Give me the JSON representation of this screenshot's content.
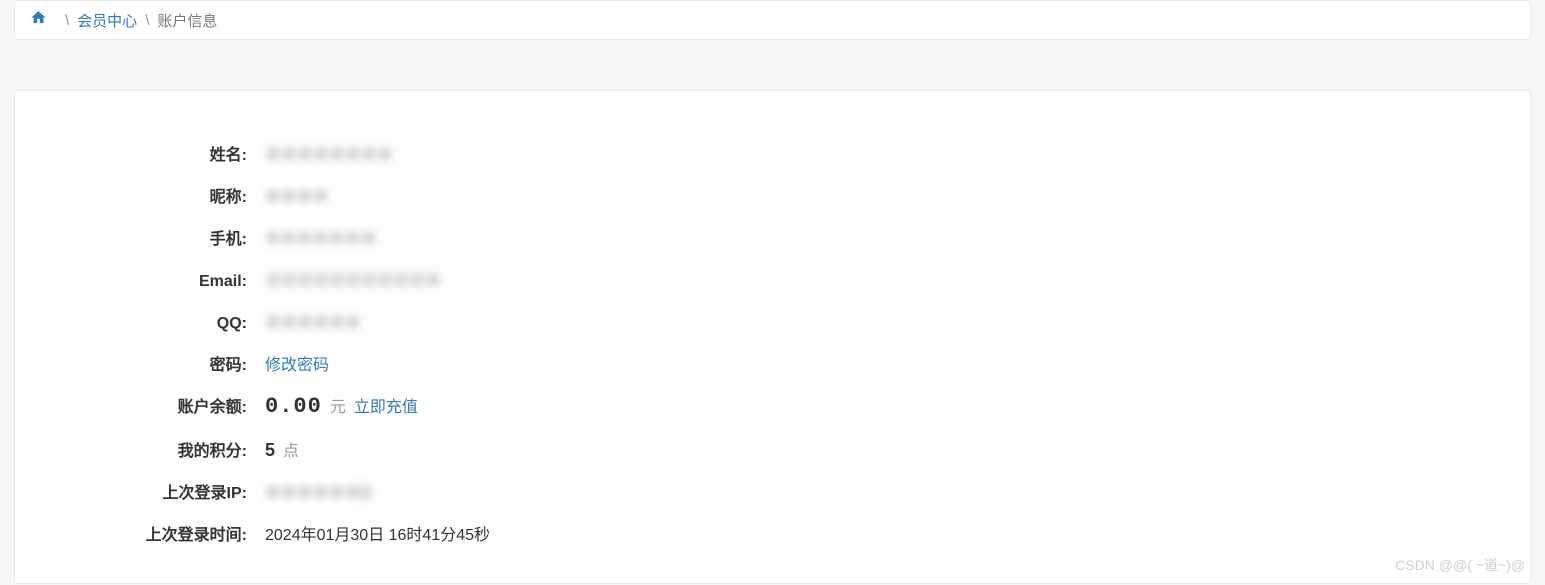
{
  "breadcrumb": {
    "member_center": "会员中心",
    "account_info": "账户信息"
  },
  "info": {
    "name_label": "姓名:",
    "name_value": "＊＊＊＊＊＊＊＊",
    "nick_label": "昵称:",
    "nick_value": "＊＊＊＊",
    "phone_label": "手机:",
    "phone_value": "＊＊＊＊＊＊＊",
    "email_label": "Email:",
    "email_value": "＊＊＊＊＊＊＊＊＊＊＊",
    "qq_label": "QQ:",
    "qq_value": "＊＊＊＊＊＊",
    "password_label": "密码:",
    "password_change": "修改密码",
    "balance_label": "账户余额:",
    "balance_value": "0.00",
    "balance_unit": "元",
    "recharge": "立即充值",
    "points_label": "我的积分:",
    "points_value": "5",
    "points_unit": "点",
    "last_ip_label": "上次登录IP:",
    "last_ip_value": "＊＊＊＊＊＊3",
    "last_time_label": "上次登录时间:",
    "last_time_value": "2024年01月30日 16时41分45秒"
  },
  "watermark": "CSDN @@( ~道~)@"
}
